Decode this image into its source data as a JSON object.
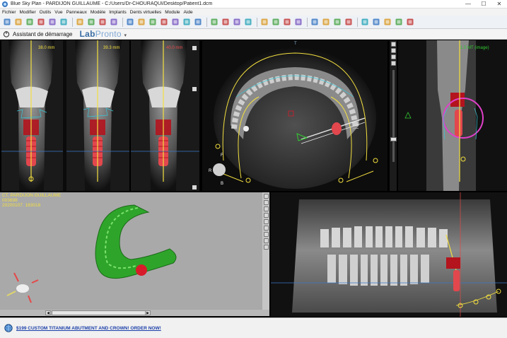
{
  "window": {
    "title": "Blue Sky Plan - PARDIJON GUILLAUME - C:/Users/Dr-CHOURAQUI/Desktop/Patient1.dcm",
    "min": "—",
    "max": "☐",
    "close": "✕"
  },
  "menu": [
    "Fichier",
    "Modifier",
    "Outils",
    "Vue",
    "Panneaux",
    "Modèle",
    "Implants",
    "Dents virtuelles",
    "Module",
    "Aide"
  ],
  "assistant": {
    "label": "Assistant de démarrage"
  },
  "brand": {
    "lab": "Lab",
    "pronto": "Pronto"
  },
  "views": {
    "cross1": {
      "mm": "38.0 mm"
    },
    "cross2": {
      "mm": "39.3 mm"
    },
    "cross3": {
      "mm": "40.0 mm"
    },
    "axial_top": "T",
    "axial_left": "R",
    "axial_f": "F",
    "axial_b": "B",
    "sagittal_mm": "1.0 MT  (image)"
  },
  "patient": {
    "name": "CT, PARDIJON GUILLAUME",
    "id": "003698",
    "date": "20200107. 183018"
  },
  "status": {
    "promo": "$199 CUSTOM TITANIUM ABUTMENT AND CROWN! ORDER NOW!"
  },
  "colors": {
    "accent": "#f3df3f",
    "implant": "#d81b2a",
    "model": "#2ea52a",
    "cyan": "#38c6d6"
  }
}
